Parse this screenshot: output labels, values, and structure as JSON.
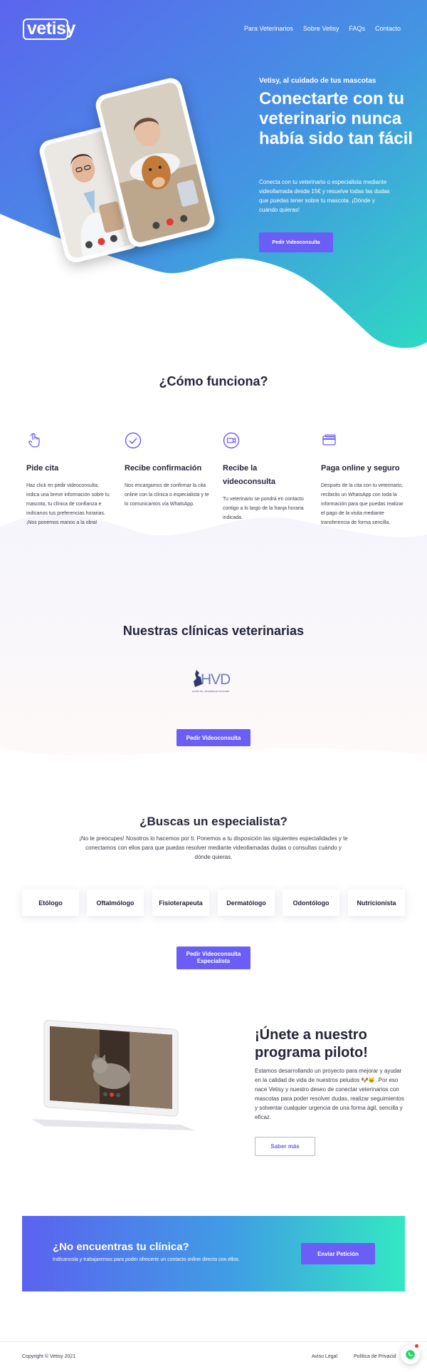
{
  "brand": {
    "logo_text": "vetisy"
  },
  "nav": {
    "items": [
      "Para Veterinarios",
      "Sobre Vetisy",
      "FAQs",
      "Contacto"
    ]
  },
  "hero": {
    "subtitle": "Vetisy, al cuidado de tus mascotas",
    "title": "Conectarte con tu veterinario nunca había sido tan fácil",
    "description": "Conecta con tu veterinario o especialista mediante videollamada desde 15€ y resuelve todas las dudas que puedas tener sobre tu mascota. ¡Dónde y cuándo quieras!",
    "cta_label": "Pedir Videoconsulta"
  },
  "how": {
    "title": "¿Cómo funciona?",
    "steps": [
      {
        "icon": "hand-pointer-icon",
        "title": "Pide cita",
        "text": "Haz click en pedir videoconsulta, indica una breve información sobre tu mascota, tu clínica de confianza e indícanos tus preferencias horarias. ¡Nos ponemos manos a la obra!"
      },
      {
        "icon": "check-circle-icon",
        "title": "Recibe confirmación",
        "text": "Nos encargamos de confirmar la cita online con la clínica o especialista y te lo comunicamos vía WhatsApp."
      },
      {
        "icon": "video-camera-icon",
        "title": "Recibe la videoconsulta",
        "text": "Tu veterinario se pondrá en contacto contigo a lo largo de la franja horaria indicada."
      },
      {
        "icon": "credit-card-icon",
        "title": "Paga online y seguro",
        "text": "Después de la cita con tu veterinario, recibirás un WhatsApp con toda la información para que puedas realizar el pago de la visita mediante transferencia de forma sencilla."
      }
    ]
  },
  "clinics": {
    "title": "Nuestras clínicas veterinarias",
    "logo_text": "HVD",
    "logo_caption": "HOSPITAL VETERINARI DOCGEN",
    "cta_label": "Pedir Videoconsulta"
  },
  "specialists": {
    "title": "¿Buscas un especialista?",
    "description": "¡No te preocupes! Nosotros lo hacemos por ti. Ponemos a tu disposición las siguientes especialidades y te conectamos con ellos para que puedas resolver mediante videollamadas dudas o consultas cuándo y dónde quieras.",
    "items": [
      "Etólogo",
      "Oftalmólogo",
      "Fisioterapeuta",
      "Dermatólogo",
      "Odontólogo",
      "Nutricionista"
    ],
    "cta_line1": "Pedir Videoconsulta",
    "cta_line2": "Especialista"
  },
  "pilot": {
    "title": "¡Únete a nuestro programa piloto!",
    "text": "Estamos desarrollando un proyecto para mejorar y ayudar en la calidad de vida de nuestros peludos 🐶🐱. Por eso nace Vetisy y nuestro deseo de conectar veterinarios con mascotas para poder resolver dudas, realizar seguimientos y solventar cualquier urgencia de una forma ágil, sencilla y eficaz.",
    "cta_label": "Saber más"
  },
  "cta_banner": {
    "title": "¿No encuentras tu clínica?",
    "text": "Indícanosla y trabajaremos para poder ofrecerte un contacto online directo con ellos.",
    "button_label": "Enviar Petición"
  },
  "footer": {
    "copyright": "Copyright © Vetisy 2021",
    "links": [
      "Aviso Legal",
      "Política de Privacid"
    ]
  },
  "colors": {
    "accent": "#6a5ef6",
    "gradient_start": "#5b62f0",
    "gradient_end": "#33e8c2"
  }
}
